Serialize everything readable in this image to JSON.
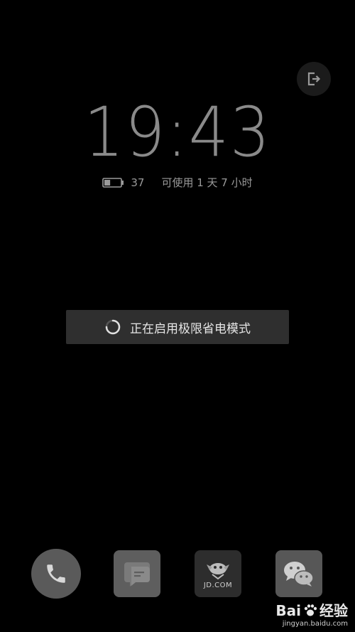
{
  "clock": {
    "time": "19:43"
  },
  "battery": {
    "level": "37",
    "remaining": "可使用 1 天 7 小时",
    "fill_fraction": 0.37
  },
  "toast": {
    "message": "正在启用极限省电模式"
  },
  "dock": {
    "apps": [
      {
        "name": "phone-icon"
      },
      {
        "name": "message-icon"
      },
      {
        "name": "jd-icon",
        "label": "JD.COM"
      },
      {
        "name": "wechat-icon"
      }
    ]
  },
  "watermark": {
    "brand": "Bai",
    "brand_suffix": "经验",
    "url": "jingyan.baidu.com"
  },
  "colors": {
    "background": "#000000",
    "clock": "#8a8a8a",
    "toast_bg": "#2f2f2f"
  }
}
